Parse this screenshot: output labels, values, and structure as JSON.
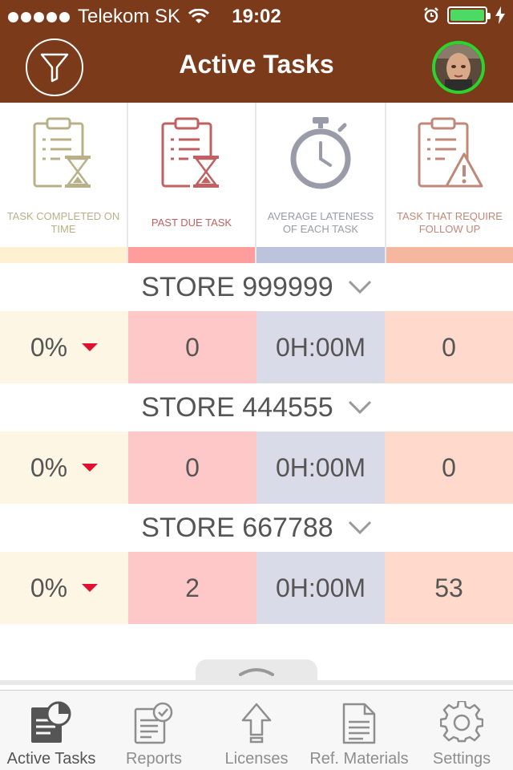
{
  "status_bar": {
    "carrier": "Telekom SK",
    "time": "19:02"
  },
  "header": {
    "title": "Active Tasks",
    "accent_color": "#7b3a1a",
    "avatar_ring_color": "#2bd42b"
  },
  "categories": [
    {
      "label": "TASK COMPLETED ON TIME",
      "icon": "clipboard-hourglass-icon",
      "color": "#b8b088",
      "strip_color": "#fdf1d2"
    },
    {
      "label": "PAST DUE TASK",
      "icon": "clipboard-hourglass-icon",
      "color": "#c06060",
      "strip_color": "#ff9c9c"
    },
    {
      "label": "AVERAGE LATENESS OF EACH TASK",
      "icon": "stopwatch-icon",
      "color": "#9a9ba8",
      "strip_color": "#bcc3dc"
    },
    {
      "label": "TASK THAT REQUIRE FOLLOW UP",
      "icon": "clipboard-warning-icon",
      "color": "#c08878",
      "strip_color": "#f5b89e"
    }
  ],
  "stores": [
    {
      "name": "STORE 999999",
      "completed": "0%",
      "past_due": "0",
      "avg_lateness": "0H:00M",
      "follow_up": "0"
    },
    {
      "name": "STORE 444555",
      "completed": "0%",
      "past_due": "0",
      "avg_lateness": "0H:00M",
      "follow_up": "0"
    },
    {
      "name": "STORE 667788",
      "completed": "0%",
      "past_due": "2",
      "avg_lateness": "0H:00M",
      "follow_up": "53"
    }
  ],
  "tabbar": {
    "items": [
      {
        "label": "Active Tasks",
        "icon": "active-tasks-icon",
        "active": true
      },
      {
        "label": "Reports",
        "icon": "reports-icon",
        "active": false
      },
      {
        "label": "Licenses",
        "icon": "licenses-icon",
        "active": false
      },
      {
        "label": "Ref. Materials",
        "icon": "ref-materials-icon",
        "active": false
      },
      {
        "label": "Settings",
        "icon": "gear-icon",
        "active": false
      }
    ]
  }
}
